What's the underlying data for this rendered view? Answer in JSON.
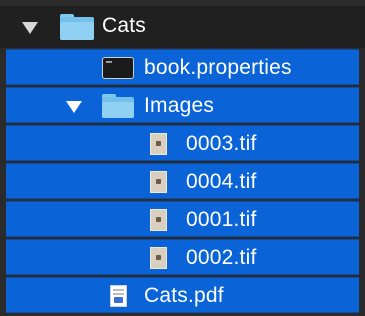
{
  "tree": {
    "root": {
      "label": "Cats",
      "icon": "folder-icon",
      "expanded": true
    },
    "items": [
      {
        "label": "book.properties",
        "icon": "terminal-file-icon"
      },
      {
        "label": "Images",
        "icon": "folder-icon",
        "expanded": true
      },
      {
        "label": "0003.tif",
        "icon": "image-file-icon"
      },
      {
        "label": "0004.tif",
        "icon": "image-file-icon"
      },
      {
        "label": "0001.tif",
        "icon": "image-file-icon"
      },
      {
        "label": "0002.tif",
        "icon": "image-file-icon"
      },
      {
        "label": "Cats.pdf",
        "icon": "pdf-file-icon"
      }
    ]
  },
  "colors": {
    "background": "#2b2b2b",
    "header_background": "#202020",
    "selection": "#0a64d7",
    "folder": "#74c0ea",
    "text": "#ffffff"
  }
}
